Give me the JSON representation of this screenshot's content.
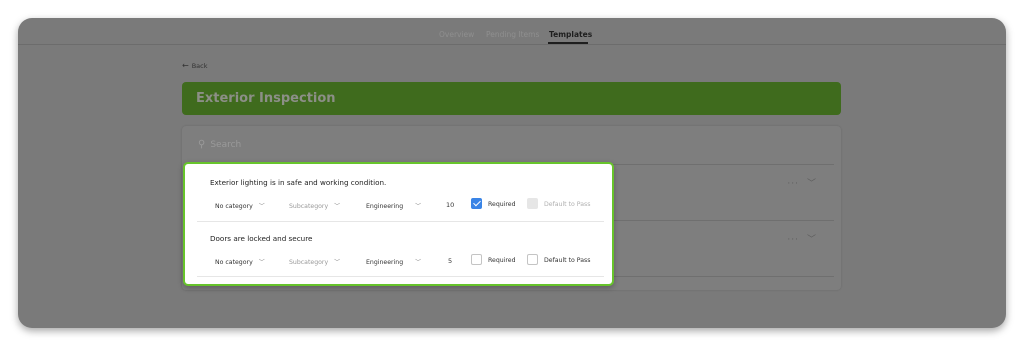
{
  "nav": {
    "tabs": [
      {
        "label": "Overview",
        "active": false
      },
      {
        "label": "Pending Items",
        "active": false
      },
      {
        "label": "Templates",
        "active": true
      }
    ]
  },
  "back_label": "Back",
  "banner": {
    "title": "Exterior Inspection",
    "color": "#3f6b1d"
  },
  "search": {
    "placeholder": "Search"
  },
  "row_actions": {
    "more": "···"
  },
  "items": [
    {
      "title": "Exterior lighting is in safe and working condition.",
      "category": "No category",
      "subcategory": "Subcategory",
      "department": "Engineering",
      "points": "10",
      "required_label": "Required",
      "required": true,
      "default_label": "Default to Pass",
      "default_to_pass": false,
      "default_disabled": true
    },
    {
      "title": "Doors are locked and secure",
      "category": "No category",
      "subcategory": "Subcategory",
      "department": "Engineering",
      "points": "5",
      "required_label": "Required",
      "required": false,
      "default_label": "Default to Pass",
      "default_to_pass": false,
      "default_disabled": false
    }
  ],
  "colors": {
    "accent_green": "#67c42b",
    "checkbox_blue": "#3a84e6"
  }
}
